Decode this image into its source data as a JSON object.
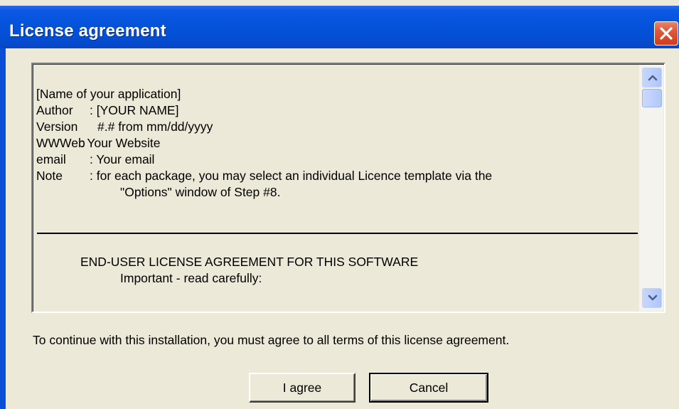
{
  "window": {
    "title": "License agreement"
  },
  "license": {
    "lines": {
      "app_name": "[Name of your application]",
      "author_key": "Author",
      "author_value": ": [YOUR NAME]",
      "version_key": "Version",
      "version_value": "#.# from mm/dd/yyyy",
      "web_key": "WWWeb",
      "web_value": ": Your Website",
      "email_key": "email",
      "email_value": ": Your email",
      "note_key": "Note",
      "note_value_1": ": for each package, you may select an individual Licence template via the",
      "note_value_2": "\"Options\" window of Step #8.",
      "eula_heading": "END-USER LICENSE AGREEMENT FOR THIS SOFTWARE",
      "eula_subheading": "Important - read carefully:"
    }
  },
  "footer": {
    "notice": "To continue with this installation, you must agree to all terms of this license agreement.",
    "agree_label": "I agree",
    "cancel_label": "Cancel"
  },
  "icons": {
    "close": "close-icon",
    "scroll_up": "chevron-up-icon",
    "scroll_down": "chevron-down-icon"
  },
  "colors": {
    "titlebar": "#0553da",
    "dialog_bg": "#ece9d8",
    "close_button": "#e0583a",
    "scrollbar_button": "#b9cdfb"
  }
}
